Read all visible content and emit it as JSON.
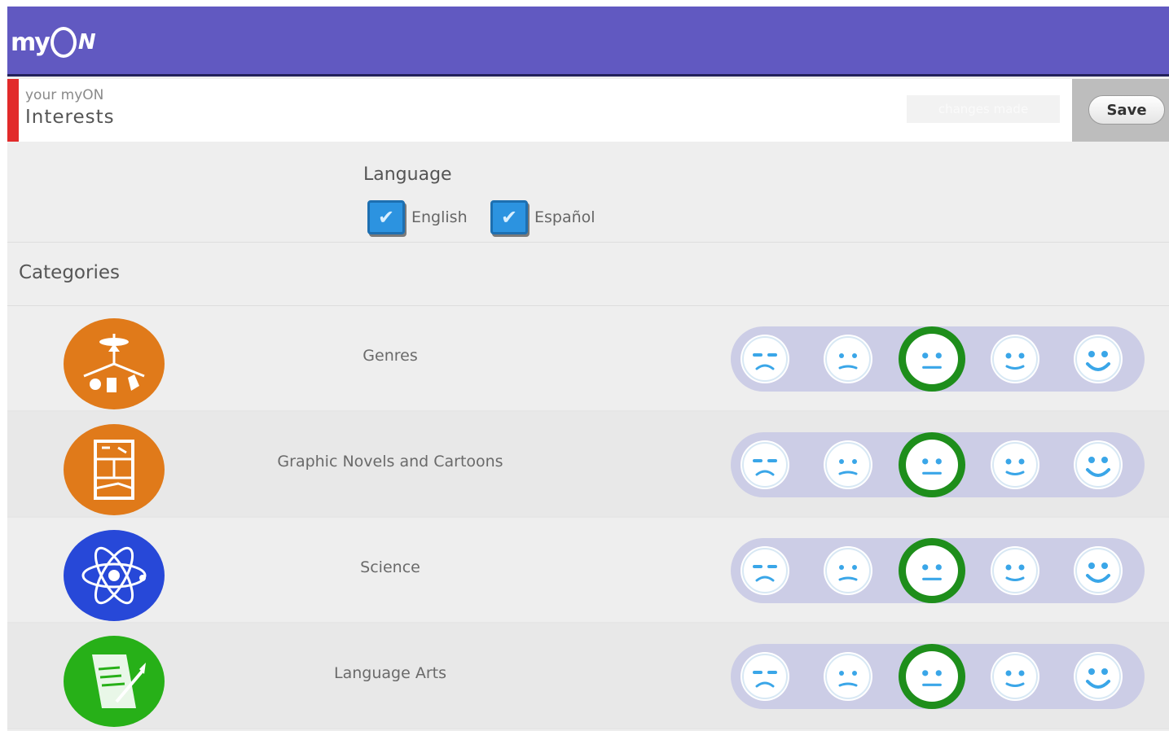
{
  "app": {
    "logo_text": "my",
    "logo_tail": "N"
  },
  "header": {
    "subtitle": "your myON",
    "title": "Interests",
    "changes_label": "changes made",
    "save_label": "Save"
  },
  "language": {
    "label": "Language",
    "options": [
      {
        "label": "English",
        "checked": true
      },
      {
        "label": "Español",
        "checked": true
      }
    ]
  },
  "categories": {
    "label": "Categories",
    "items": [
      {
        "name": "Genres",
        "icon": "genres-icon",
        "icon_color": "#e07a1a",
        "rating": 3
      },
      {
        "name": "Graphic Novels and Cartoons",
        "icon": "comic-panel-icon",
        "icon_color": "#e07a1a",
        "rating": 3
      },
      {
        "name": "Science",
        "icon": "atom-icon",
        "icon_color": "#2748d8",
        "rating": 3
      },
      {
        "name": "Language Arts",
        "icon": "scroll-quill-icon",
        "icon_color": "#27b018",
        "rating": 3
      }
    ]
  },
  "rating_scale": [
    "very-sad",
    "sad",
    "neutral",
    "happy",
    "very-happy"
  ],
  "colors": {
    "header_bg": "#6159c1",
    "accent_red": "#e22a2a",
    "checkbox_blue": "#2c93e0",
    "selected_green": "#1e8e1b",
    "face_blue": "#3aa6e8"
  }
}
